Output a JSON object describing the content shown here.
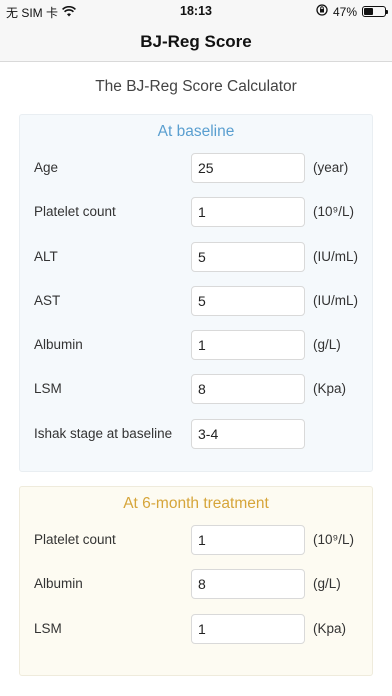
{
  "status_bar": {
    "carrier": "无 SIM 卡",
    "time": "18:13",
    "battery_percent": "47%",
    "battery_level": 0.47,
    "icons": [
      "wifi-icon",
      "orientation-lock-icon",
      "battery-icon"
    ]
  },
  "nav": {
    "title": "BJ-Reg Score"
  },
  "page": {
    "heading": "The BJ-Reg Score Calculator"
  },
  "baseline": {
    "title": "At baseline",
    "rows": [
      {
        "label": "Age",
        "value": "25",
        "unit": "(year)"
      },
      {
        "label": "Platelet count",
        "value": "1",
        "unit": "(10⁹/L)"
      },
      {
        "label": "ALT",
        "value": "5",
        "unit": "(IU/mL)"
      },
      {
        "label": "AST",
        "value": "5",
        "unit": "(IU/mL)"
      },
      {
        "label": "Albumin",
        "value": "1",
        "unit": "(g/L)"
      },
      {
        "label": "LSM",
        "value": "8",
        "unit": "(Kpa)"
      },
      {
        "label": "Ishak stage at baseline",
        "value": "3-4",
        "unit": ""
      }
    ]
  },
  "six_month": {
    "title": "At 6-month treatment",
    "rows": [
      {
        "label": "Platelet count",
        "value": "1",
        "unit": "(10⁹/L)"
      },
      {
        "label": "Albumin",
        "value": "8",
        "unit": "(g/L)"
      },
      {
        "label": "LSM",
        "value": "1",
        "unit": "(Kpa)"
      }
    ]
  },
  "colors": {
    "baseline_accent": "#5a9fd0",
    "six_month_accent": "#d6a53a",
    "baseline_bg": "#f5f9fc",
    "six_month_bg": "#fdfbf2"
  }
}
